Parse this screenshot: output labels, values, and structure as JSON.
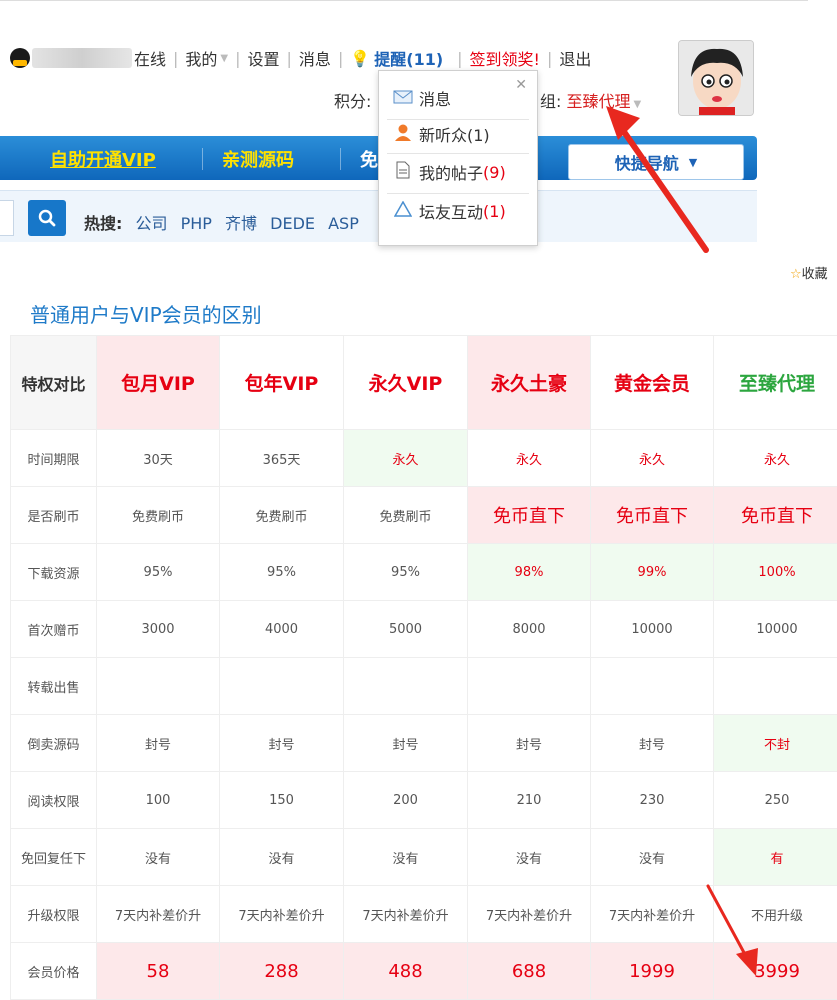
{
  "header": {
    "online_label": "在线",
    "nav": [
      "我的",
      "设置",
      "消息",
      "提醒(11)",
      "签到领奖!",
      "退出"
    ],
    "points_label": "积分:",
    "group_label": "组:",
    "group_value": "至臻代理"
  },
  "dropdown": {
    "items": [
      "消息",
      "新听众(1)",
      "我的帖子",
      "(9)",
      "坛友互动",
      "(1)"
    ]
  },
  "navbar": {
    "items": [
      "自助开通VIP",
      "亲测源码",
      "免"
    ],
    "quick_nav": "快捷导航"
  },
  "search": {
    "hot_label": "热搜:",
    "hot_terms": [
      "公司",
      "PHP",
      "齐博",
      "DEDE",
      "ASP"
    ]
  },
  "favorite": "收藏",
  "section_title": "普通用户与VIP会员的区别",
  "table": {
    "header": [
      "特权对比",
      "包月VIP",
      "包年VIP",
      "永久VIP",
      "永久土豪",
      "黄金会员",
      "至臻代理"
    ],
    "rows": [
      [
        "时间期限",
        "30天",
        "365天",
        "永久",
        "永久",
        "永久",
        "永久"
      ],
      [
        "是否刷币",
        "免费刷币",
        "免费刷币",
        "免费刷币",
        "免币直下",
        "免币直下",
        "免币直下"
      ],
      [
        "下载资源",
        "95%",
        "95%",
        "95%",
        "98%",
        "99%",
        "100%"
      ],
      [
        "首次赠币",
        "3000",
        "4000",
        "5000",
        "8000",
        "10000",
        "10000"
      ],
      [
        "转载出售",
        "",
        "",
        "",
        "",
        "",
        ""
      ],
      [
        "倒卖源码",
        "封号",
        "封号",
        "封号",
        "封号",
        "封号",
        "不封"
      ],
      [
        "阅读权限",
        "100",
        "150",
        "200",
        "210",
        "230",
        "250"
      ],
      [
        "免回复任下",
        "没有",
        "没有",
        "没有",
        "没有",
        "没有",
        "有"
      ],
      [
        "升级权限",
        "7天内补差价升",
        "7天内补差价升",
        "7天内补差价升",
        "7天内补差价升",
        "7天内补差价升",
        "不用升级"
      ],
      [
        "会员价格",
        "58",
        "288",
        "488",
        "688",
        "1999",
        "3999"
      ]
    ]
  }
}
